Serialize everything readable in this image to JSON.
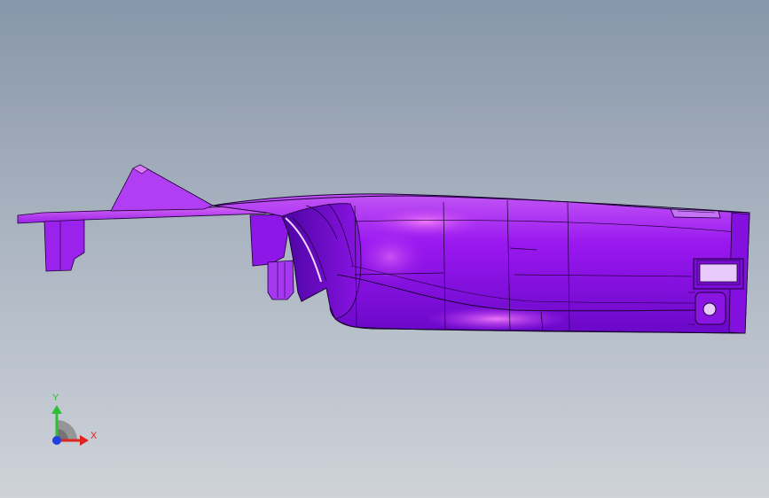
{
  "viewport": {
    "background_top": "#8796aa",
    "background_bottom": "#cfd3d9"
  },
  "model": {
    "part_color": "#9b1cf2",
    "highlight_color": "#e25cf7",
    "shadow_color": "#5a06b8",
    "edge_color": "#1a0033"
  },
  "triad": {
    "x_label": "X",
    "y_label": "Y",
    "x_color": "#e0231c",
    "y_color": "#2fbf35",
    "z_color": "#1f3fe0"
  }
}
